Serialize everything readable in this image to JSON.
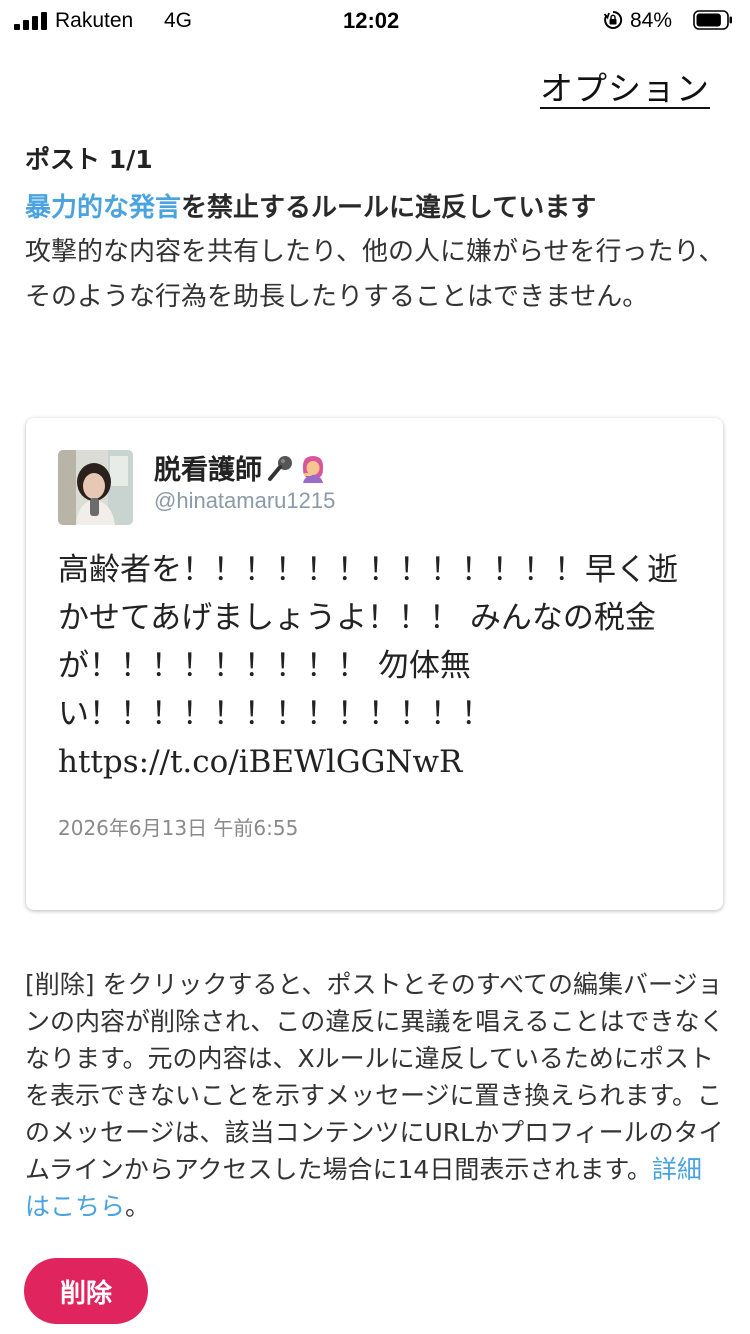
{
  "status_bar": {
    "carrier": "Rakuten",
    "network": "4G",
    "time": "12:02",
    "battery_percent": "84%",
    "battery_level": 0.84
  },
  "header": {
    "options_label": "オプション"
  },
  "violation": {
    "post_count": "ポスト 1/1",
    "rule_link": "暴力的な発言",
    "rule_rest": "を禁止するルールに違反しています",
    "description": "攻撃的な内容を共有したり、他の人に嫌がらせを行ったり、そのような行為を助長したりすることはできません。"
  },
  "tweet": {
    "author_name": "脱看護師",
    "author_emoji": [
      "microphone-icon",
      "woman-emoji-icon"
    ],
    "handle": "@hinatamaru1215",
    "text": "高齢者を！！！！！！！！！！！！！早く逝かせてあげましょうよ！！！ みんなの税金が！！！！！！！！！ 勿体無い！！！！！！！！！！！！！",
    "link": "https://t.co/iBEWlGGNwR",
    "date": "2026年6月13日 午前6:55"
  },
  "explanation": {
    "body": "[削除] をクリックすると、ポストとそのすべての編集バージョンの内容が削除され、この違反に異議を唱えることはできなくなります。元の内容は、Xルールに違反しているためにポストを表示できないことを示すメッセージに置き換えられます。このメッセージは、該当コンテンツにURLかプロフィールのタイムラインからアクセスした場合に14日間表示されます。",
    "link": "詳細はこちら",
    "end": "。"
  },
  "actions": {
    "delete_label": "削除"
  },
  "colors": {
    "link": "#4aa3df",
    "delete_button": "#e0245e"
  }
}
